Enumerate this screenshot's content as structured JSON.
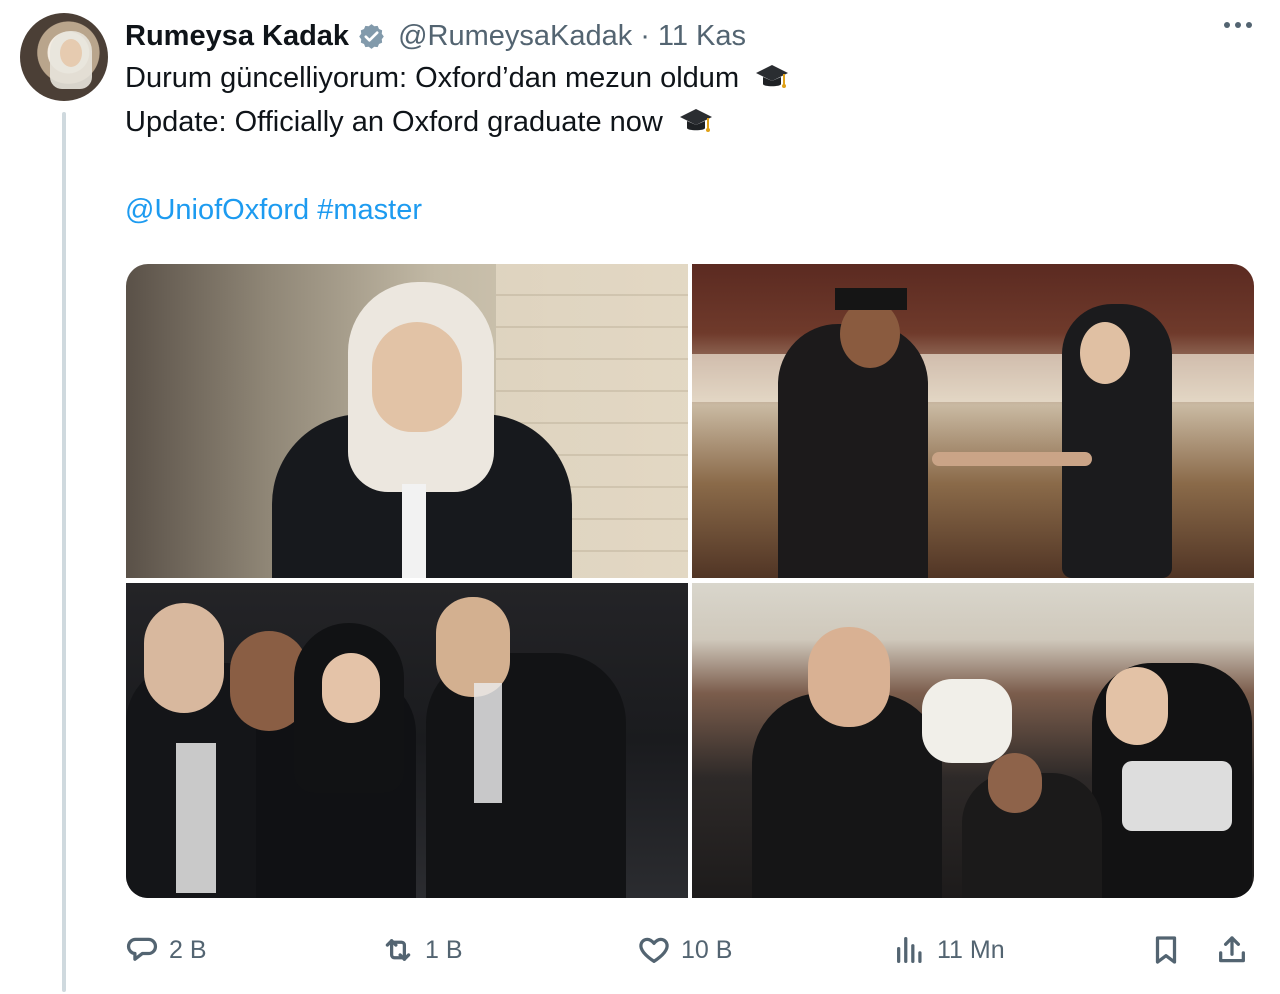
{
  "tweet": {
    "author_name": "Rumeysa Kadak",
    "handle": "@RumeysaKadak",
    "separator": "·",
    "date": "11 Kas",
    "line1": "Durum güncelliyorum: Oxford’dan mezun oldum",
    "line2": "Update: Officially an Oxford graduate now",
    "mentions": "@UniofOxford #master"
  },
  "actions": {
    "replies": "2 B",
    "retweets": "1 B",
    "likes": "10 B",
    "views": "11 Mn"
  },
  "icons": {
    "verified": "verified-badge-icon",
    "graduation": "graduation-cap-emoji",
    "more": "more-options-icon",
    "reply": "reply-icon",
    "retweet": "retweet-icon",
    "like": "like-icon",
    "views": "views-icon",
    "bookmark": "bookmark-icon",
    "share": "share-icon"
  },
  "colors": {
    "link": "#1d9bf0",
    "muted": "#536471",
    "text": "#0f1419"
  }
}
